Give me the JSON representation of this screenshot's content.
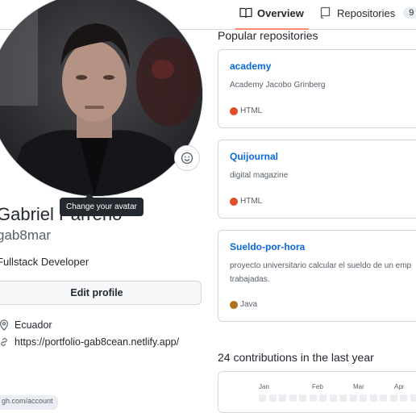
{
  "tabs": {
    "overview": "Overview",
    "repositories": "Repositories",
    "repositories_count": "9"
  },
  "profile": {
    "avatar_tooltip": "Change your avatar",
    "name": "Gabriel Parreño",
    "login": "gab8mar",
    "bio": "Fullstack Developer",
    "edit_button": "Edit profile",
    "location": "Ecuador",
    "website": "https://portfolio-gab8cean.netlify.app/",
    "bottom_tag": "gh.com/account"
  },
  "popular": {
    "title": "Popular repositories",
    "repos": [
      {
        "name": "academy",
        "description": "Academy Jacobo Grinberg",
        "language": "HTML",
        "language_color": "#e34c26"
      },
      {
        "name": "Quijournal",
        "description": "digital magazine",
        "language": "HTML",
        "language_color": "#e34c26"
      },
      {
        "name": "Sueldo-por-hora",
        "description": "proyecto universitario calcular el sueldo de un empleado por horas trabajadas.",
        "description_line1": "proyecto universitario calcular el sueldo de un emp",
        "description_line2": "trabajadas.",
        "language": "Java",
        "language_color": "#b07219"
      }
    ]
  },
  "contributions": {
    "title": "24 contributions in the last year",
    "months": [
      "Jan",
      "Feb",
      "Mar",
      "Apr"
    ]
  },
  "colors": {
    "link": "#0969da",
    "tab_underline": "#fd8c73",
    "border": "#d0d7de"
  }
}
